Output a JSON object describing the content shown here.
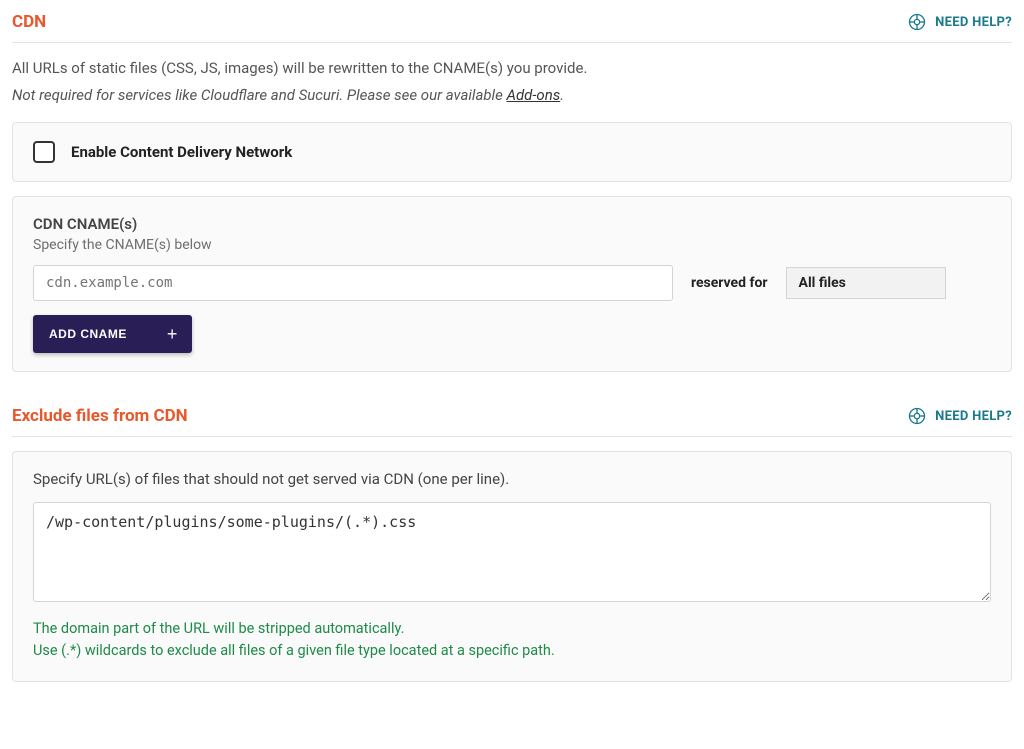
{
  "cdn": {
    "title": "CDN",
    "help_label": "NEED HELP?",
    "desc_line1": "All URLs of static files (CSS, JS, images) will be rewritten to the CNAME(s) you provide.",
    "desc_line2_prefix": "Not required for services like Cloudflare and Sucuri. Please see our available ",
    "desc_line2_link": "Add-ons",
    "desc_line2_suffix": ".",
    "enable_label": "Enable Content Delivery Network",
    "cname_title": "CDN CNAME(s)",
    "cname_desc": "Specify the CNAME(s) below",
    "cname_placeholder": "cdn.example.com",
    "cname_value": "",
    "reserved_label": "reserved for",
    "reserved_value": "All files",
    "add_cname_label": "ADD CNAME"
  },
  "exclude": {
    "title": "Exclude files from CDN",
    "help_label": "NEED HELP?",
    "desc": "Specify URL(s) of files that should not get served via CDN (one per line).",
    "textarea_value": "/wp-content/plugins/some-plugins/(.*).css",
    "hint_line1": "The domain part of the URL will be stripped automatically.",
    "hint_line2": "Use (.*) wildcards to exclude all files of a given file type located at a specific path."
  }
}
